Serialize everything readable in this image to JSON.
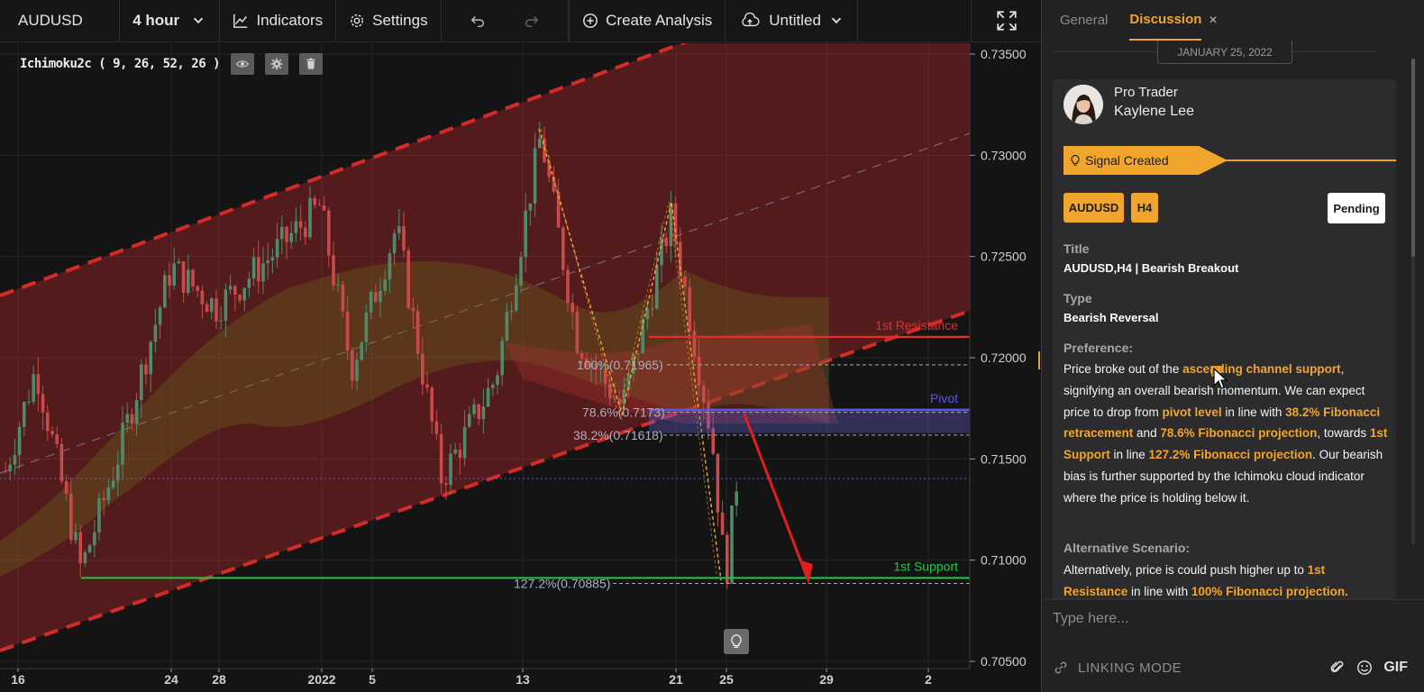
{
  "toolbar": {
    "symbol": "AUDUSD",
    "interval": "4 hour",
    "indicators": "Indicators",
    "settings": "Settings",
    "create_analysis": "Create Analysis",
    "project": "Untitled"
  },
  "indicator": {
    "name": "Ichimoku2c ( 9, 26, 52, 26 )"
  },
  "colors": {
    "accent": "#f2a52d",
    "resistance": "#e0302e",
    "support": "#1fc84a",
    "pivot": "#5a5ae0",
    "bull_candle": "#4f8a6a",
    "bear_candle": "#c84a4a",
    "channel": "#d42a2a"
  },
  "chart_data": {
    "type": "candlestick",
    "symbol": "AUDUSD",
    "timeframe": "H4",
    "ylim": [
      0.705,
      0.735
    ],
    "y_ticks": [
      "0.73500",
      "0.73000",
      "0.72500",
      "0.72000",
      "0.71500",
      "0.71000",
      "0.70500"
    ],
    "x_ticks": [
      "16",
      "24",
      "28",
      "2022",
      "5",
      "13",
      "21",
      "25",
      "29",
      "2"
    ],
    "levels": [
      {
        "label": "1st Resistance",
        "value": 0.72103,
        "tag": "0.72103"
      },
      {
        "label": "Pivot",
        "value": 0.71742,
        "tag": "0.71742"
      },
      {
        "label": "",
        "value": 0.71403,
        "tag": "0.71403"
      },
      {
        "label": "1st Support",
        "value": 0.70912,
        "tag": "0.70912"
      }
    ],
    "fibonacci": [
      {
        "label": "100%(0.71965)",
        "value": 0.71965
      },
      {
        "label": "78.6%(0.7173)",
        "value": 0.7173
      },
      {
        "label": "38.2%(0.71618)",
        "value": 0.71618
      },
      {
        "label": "127.2%(0.70885)",
        "value": 0.70885
      }
    ]
  },
  "discussion": {
    "tabs": [
      "General",
      "Discussion"
    ],
    "active_tab": "Discussion",
    "date": "JANUARY 25, 2022",
    "author_role": "Pro Trader",
    "author_name": "Kaylene Lee",
    "signal_label": "Signal Created",
    "symbol_chip": "AUDUSD",
    "timeframe_chip": "H4",
    "status": "Pending",
    "title_label": "Title",
    "title_value": "AUDUSD,H4 | Bearish Breakout",
    "type_label": "Type",
    "type_value": "Bearish Reversal",
    "preference_label": "Preference:",
    "preference": [
      {
        "t": "Price broke out of the "
      },
      {
        "t": "ascending channel support",
        "hl": true
      },
      {
        "t": ", signifying an overall bearish momentum. We can expect price to drop from "
      },
      {
        "t": "pivot level",
        "hl": true
      },
      {
        "t": " in line with "
      },
      {
        "t": "38.2% Fibonacci retracement",
        "hl": true
      },
      {
        "t": " and "
      },
      {
        "t": "78.6% Fibonacci projection",
        "hl": true
      },
      {
        "t": ", towards "
      },
      {
        "t": "1st Support",
        "hl": true
      },
      {
        "t": " in line "
      },
      {
        "t": "127.2% Fibonacci projection",
        "hl": true
      },
      {
        "t": ". Our bearish bias is further supported by the Ichimoku cloud indicator where the price is holding below it."
      }
    ],
    "alternative_label": "Alternative Scenario:",
    "alternative": [
      {
        "t": "Alternatively, price is could push higher up to "
      },
      {
        "t": "1st Resistance",
        "hl": true
      },
      {
        "t": " in line with "
      },
      {
        "t": "100% Fibonacci projection.",
        "hl": true
      }
    ],
    "input_placeholder": "Type here...",
    "linking_mode": "LINKING MODE",
    "gif": "GIF"
  }
}
